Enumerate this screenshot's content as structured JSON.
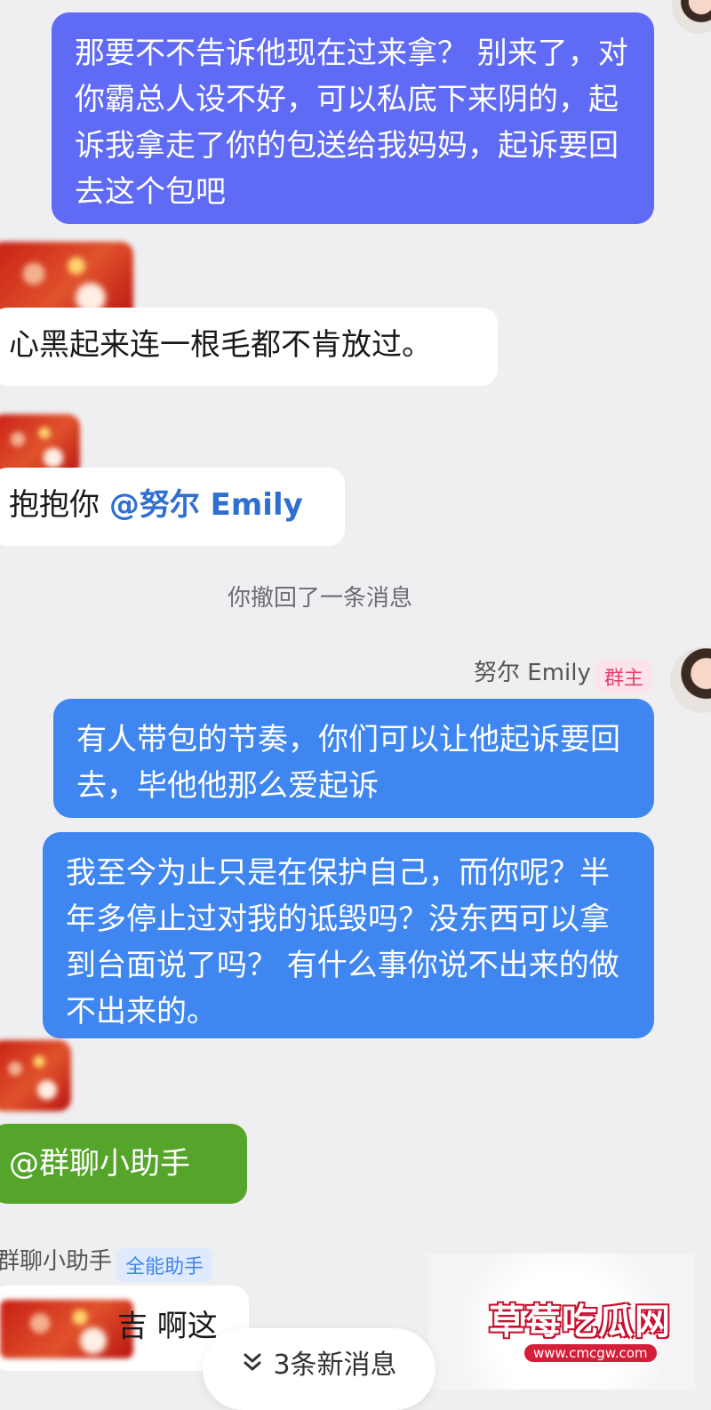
{
  "messages": {
    "m1": "那要不不告诉他现在过来拿？ 别来了，对你霸总人设不好，可以私底下来阴的，起诉我拿走了你的包送给我妈妈，起诉要回去这个包吧",
    "m2": "心黑起来连一根毛都不肯放过。",
    "m3_text": "抱抱你 ",
    "m3_mention": "@努尔 Emily",
    "recall_notice": "你撤回了一条消息",
    "owner_name": "努尔 Emily",
    "owner_tag": "群主",
    "m4": "有人带包的节奏，你们可以让他起诉要回去，毕他他那么爱起诉",
    "m5": "我至今为止只是在保护自己，而你呢？半年多停止过对我的诋毁吗？没东西可以拿到台面说了吗？ 有什么事你说不出来的做不出来的。",
    "m6": "@群聊小助手",
    "assistant_name": "群聊小助手",
    "assistant_tag": "全能助手",
    "m7_visible": "吉 啊这"
  },
  "new_messages_bar": {
    "icon": "double-chevron-down-icon",
    "label": "3条新消息"
  },
  "watermark": {
    "title": "草莓吃瓜网",
    "url": "www.cmcgw.com"
  },
  "colors": {
    "purple_bubble": "#5f6af5",
    "blue_bubble": "#3f86f0",
    "green_bubble": "#56a52b",
    "background": "#efeff1"
  }
}
